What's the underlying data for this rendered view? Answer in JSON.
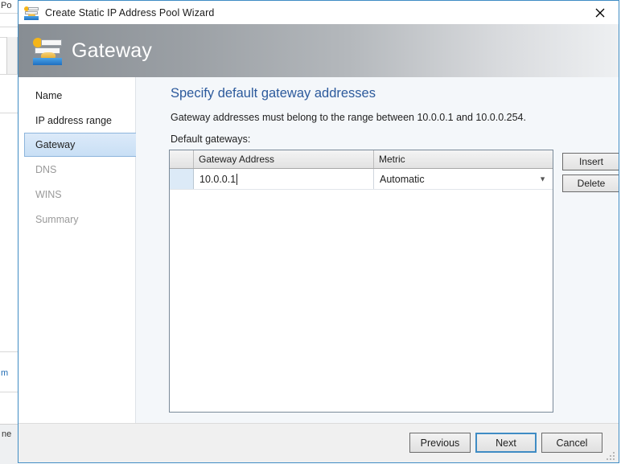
{
  "window": {
    "title": "Create Static IP Address Pool Wizard",
    "title_icon": "ip-pool-wizard-icon",
    "close_icon": "close-icon",
    "banner_title": "Gateway",
    "banner_icon": "ip-pool-wizard-icon",
    "accent_color": "#3f8cc4",
    "banner_gradient_from": "#878d93",
    "banner_gradient_to": "#eef0f2"
  },
  "sidebar": {
    "items": [
      {
        "label": "Name",
        "state": "visited"
      },
      {
        "label": "IP address range",
        "state": "visited"
      },
      {
        "label": "Gateway",
        "state": "selected"
      },
      {
        "label": "DNS",
        "state": "pending"
      },
      {
        "label": "WINS",
        "state": "pending"
      },
      {
        "label": "Summary",
        "state": "pending"
      }
    ]
  },
  "main": {
    "heading": "Specify default gateway addresses",
    "heading_color": "#2c5a9c",
    "description": "Gateway addresses must belong to the range between 10.0.0.1 and 10.0.0.254.",
    "grid_label": "Default gateways:",
    "grid": {
      "columns": [
        "",
        "Gateway Address",
        "Metric"
      ],
      "rows": [
        {
          "selected": true,
          "gateway_address": "10.0.0.1",
          "metric": "Automatic",
          "metric_icon": "chevron-down-icon",
          "metric_options": [
            "Automatic"
          ]
        }
      ]
    },
    "side_buttons": {
      "insert": "Insert",
      "delete": "Delete"
    }
  },
  "footer": {
    "previous": "Previous",
    "next": "Next",
    "cancel": "Cancel",
    "focused_button": "Next",
    "resize_grip_icon": "resize-grip-icon"
  },
  "background": {
    "top_fragment": "Po",
    "mid_fragment": "m",
    "bottom_fragment": "ne"
  }
}
